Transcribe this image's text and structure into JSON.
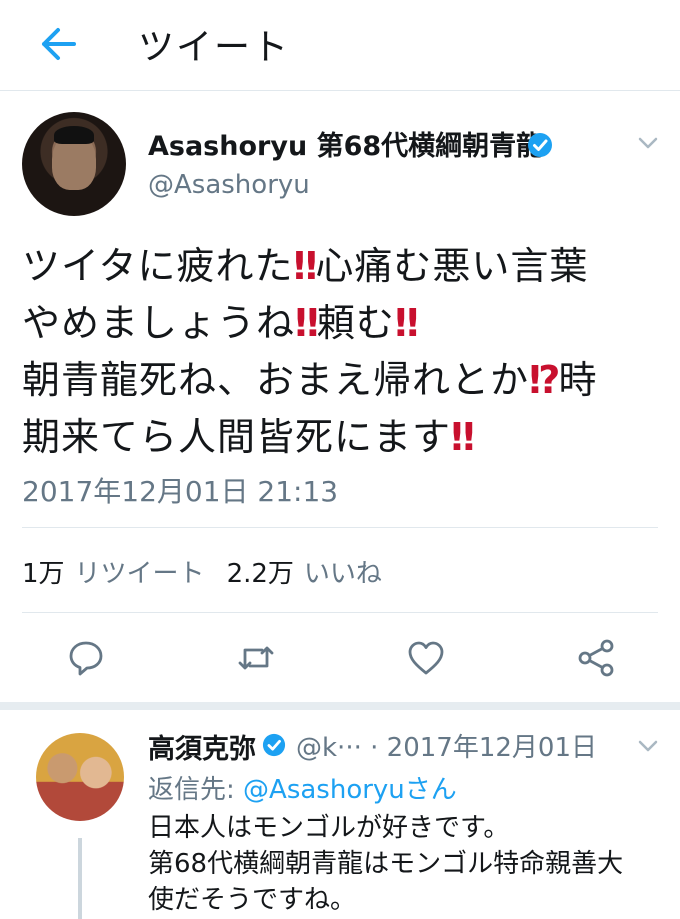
{
  "header": {
    "title": "ツイート",
    "back_icon": "back-arrow-icon",
    "accent": "#1da1f2"
  },
  "tweet": {
    "display_name": "Asashoryu 第68代横綱朝青龍",
    "handle": "@Asashoryu",
    "text_lines": [
      [
        "ツイタに疲れた",
        "‼",
        "心痛む悪い言葉"
      ],
      [
        "やめましょうね",
        "‼",
        "頼む",
        "‼"
      ],
      [
        "朝青龍死ね、おまえ帰れとか",
        "⁉",
        "時"
      ],
      [
        "期来てら人間皆死にます",
        "‼"
      ]
    ],
    "timestamp": "2017年12月01日 21:13",
    "retweets": {
      "count": "1万",
      "label": "リツイート"
    },
    "likes": {
      "count": "2.2万",
      "label": "いいね"
    },
    "actions": [
      "reply-icon",
      "retweet-icon",
      "like-icon",
      "share-icon"
    ]
  },
  "reply": {
    "display_name": "高須克弥",
    "handle_truncated": "@k···",
    "date": "· 2017年12月01日",
    "reply_to_prefix": "返信先: ",
    "reply_to_handle": "@Asashoryu",
    "reply_to_suffix": "さん",
    "text_lines": [
      "日本人はモンゴルが好きです。",
      "第68代横綱朝青龍はモンゴル特命親善大",
      "使だそうですね。"
    ]
  },
  "colors": {
    "text": "#14171a",
    "secondary": "#657786",
    "accent": "#1da1f2",
    "emoji_red": "#c8102e",
    "divider": "#e1e8ed"
  }
}
